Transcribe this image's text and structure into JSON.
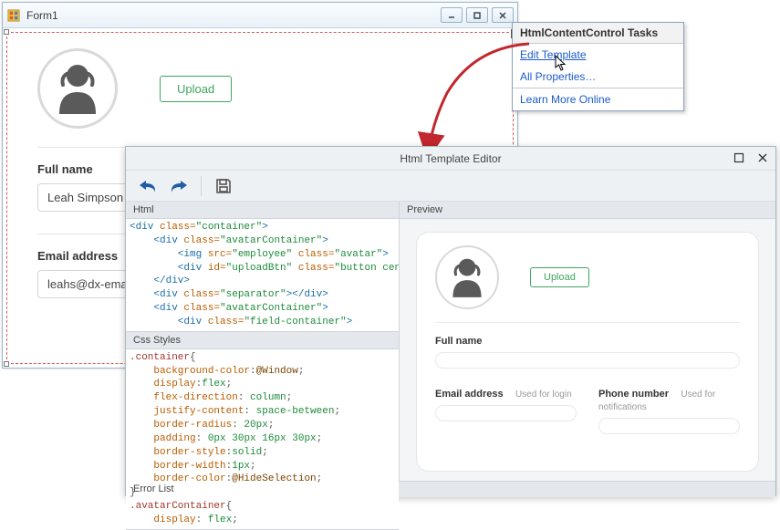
{
  "form1": {
    "title": "Form1",
    "upload_label": "Upload",
    "fullname_label": "Full name",
    "fullname_value": "Leah Simpson",
    "email_label": "Email address",
    "email_value": "leahs@dx-email"
  },
  "tasks": {
    "title": "HtmlContentControl Tasks",
    "edit": "Edit Template",
    "allprops": "All Properties…",
    "learnmore": "Learn More Online"
  },
  "editor": {
    "title": "Html Template Editor",
    "panes": {
      "html": "Html",
      "css": "Css Styles",
      "preview": "Preview",
      "errorlist": "Error List"
    },
    "html_code": {
      "l1a": "<div",
      "l1b": " class=",
      "l1c": "\"container\"",
      "l1d": ">",
      "l2a": "    <div",
      "l2b": " class=",
      "l2c": "\"avatarContainer\"",
      "l2d": ">",
      "l3a": "        <img",
      "l3b": " src=",
      "l3c": "\"employee\"",
      "l3d": " class=",
      "l3e": "\"avatar\"",
      "l3f": ">",
      "l4a": "        <div",
      "l4b": " id=",
      "l4c": "\"uploadBtn\"",
      "l4d": " class=",
      "l4e": "\"button centere",
      "l5a": "    </div>",
      "l6a": "    <div",
      "l6b": " class=",
      "l6c": "\"separator\"",
      "l6d": "></div>",
      "l7a": "    <div",
      "l7b": " class=",
      "l7c": "\"avatarContainer\"",
      "l7d": ">",
      "l8a": "        <div",
      "l8b": " class=",
      "l8c": "\"field-container\"",
      "l8d": ">"
    },
    "css_code": {
      "l1": ".container",
      "l1b": "{",
      "l2a": "    background-color",
      "l2b": ":",
      "l2c": "@Window",
      "l2d": ";",
      "l3a": "    display",
      "l3b": ":",
      "l3c": "flex",
      "l3d": ";",
      "l4a": "    flex-direction",
      "l4b": ":",
      "l4c": " column",
      "l4d": ";",
      "l5a": "    justify-content",
      "l5b": ":",
      "l5c": " space-between",
      "l5d": ";",
      "l6a": "    border-radius",
      "l6b": ":",
      "l6c": " 20px",
      "l6d": ";",
      "l7a": "    padding",
      "l7b": ":",
      "l7c": " 0px 30px 16px 30px",
      "l7d": ";",
      "l8a": "    border-style",
      "l8b": ":",
      "l8c": "solid",
      "l8d": ";",
      "l9a": "    border-width",
      "l9b": ":",
      "l9c": "1px",
      "l9d": ";",
      "l10a": "    border-color",
      "l10b": ":",
      "l10c": "@HideSelection",
      "l10d": ";",
      "l11": "}",
      "l12": ".avatarContainer",
      "l12b": "{",
      "l13a": "    display",
      "l13b": ":",
      "l13c": " flex",
      "l13d": ";"
    },
    "preview": {
      "upload": "Upload",
      "fullname": "Full name",
      "email": "Email address",
      "email_hint": "Used for login",
      "phone": "Phone number",
      "phone_hint": "Used for notifications"
    }
  }
}
